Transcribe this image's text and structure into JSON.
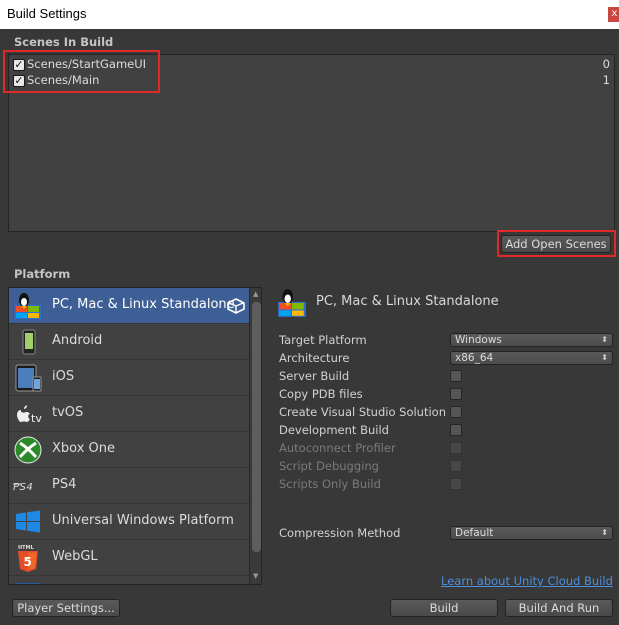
{
  "window": {
    "title": "Build Settings",
    "close_glyph": "x"
  },
  "scenes": {
    "label": "Scenes In Build",
    "items": [
      {
        "name": "Scenes/StartGameUI",
        "index": "0",
        "checked": true
      },
      {
        "name": "Scenes/Main",
        "index": "1",
        "checked": true
      }
    ],
    "add_open_scenes": "Add Open Scenes"
  },
  "platform": {
    "label": "Platform",
    "items": [
      {
        "label": "PC, Mac & Linux Standalone",
        "icon": "pc-standalone-icon",
        "selected": true
      },
      {
        "label": "Android",
        "icon": "android-icon"
      },
      {
        "label": "iOS",
        "icon": "ios-icon"
      },
      {
        "label": "tvOS",
        "icon": "tvos-icon"
      },
      {
        "label": "Xbox One",
        "icon": "xbox-icon"
      },
      {
        "label": "PS4",
        "icon": "ps4-icon"
      },
      {
        "label": "Universal Windows Platform",
        "icon": "windows-icon"
      },
      {
        "label": "WebGL",
        "icon": "html5-icon"
      }
    ]
  },
  "settings": {
    "header": "PC, Mac & Linux Standalone",
    "target_platform": {
      "label": "Target Platform",
      "value": "Windows"
    },
    "architecture": {
      "label": "Architecture",
      "value": "x86_64"
    },
    "server_build": "Server Build",
    "copy_pdb": "Copy PDB files",
    "create_vs": "Create Visual Studio Solution",
    "dev_build": "Development Build",
    "autoconnect": "Autoconnect Profiler",
    "script_debugging": "Script Debugging",
    "scripts_only": "Scripts Only Build",
    "compression": {
      "label": "Compression Method",
      "value": "Default"
    },
    "cloud_link": "Learn about Unity Cloud Build"
  },
  "buttons": {
    "player_settings": "Player Settings...",
    "build": "Build",
    "build_and_run": "Build And Run"
  },
  "colors": {
    "selected_row": "#3e5f96",
    "link": "#4c8fdd",
    "highlight_box": "#e02a2a"
  }
}
